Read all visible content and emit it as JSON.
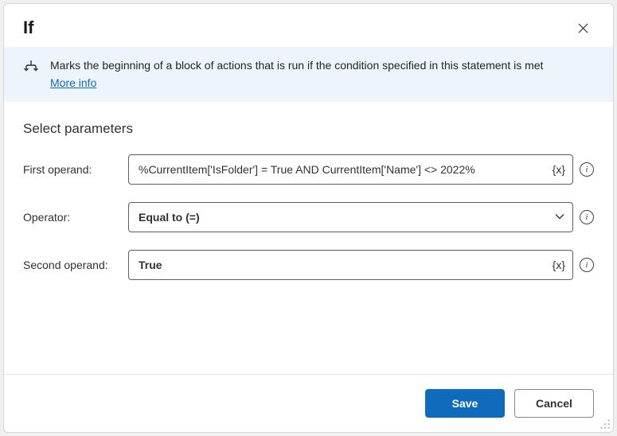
{
  "header": {
    "title": "If"
  },
  "banner": {
    "text": "Marks the beginning of a block of actions that is run if the condition specified in this statement is met",
    "more_info": "More info"
  },
  "section": {
    "title": "Select parameters"
  },
  "params": {
    "first_operand": {
      "label": "First operand:",
      "value": "%CurrentItem['IsFolder'] = True AND CurrentItem['Name'] <> 2022%"
    },
    "operator": {
      "label": "Operator:",
      "value": "Equal to (=)"
    },
    "second_operand": {
      "label": "Second operand:",
      "value": "True"
    }
  },
  "footer": {
    "save": "Save",
    "cancel": "Cancel"
  },
  "glyphs": {
    "variable": "{x}"
  }
}
